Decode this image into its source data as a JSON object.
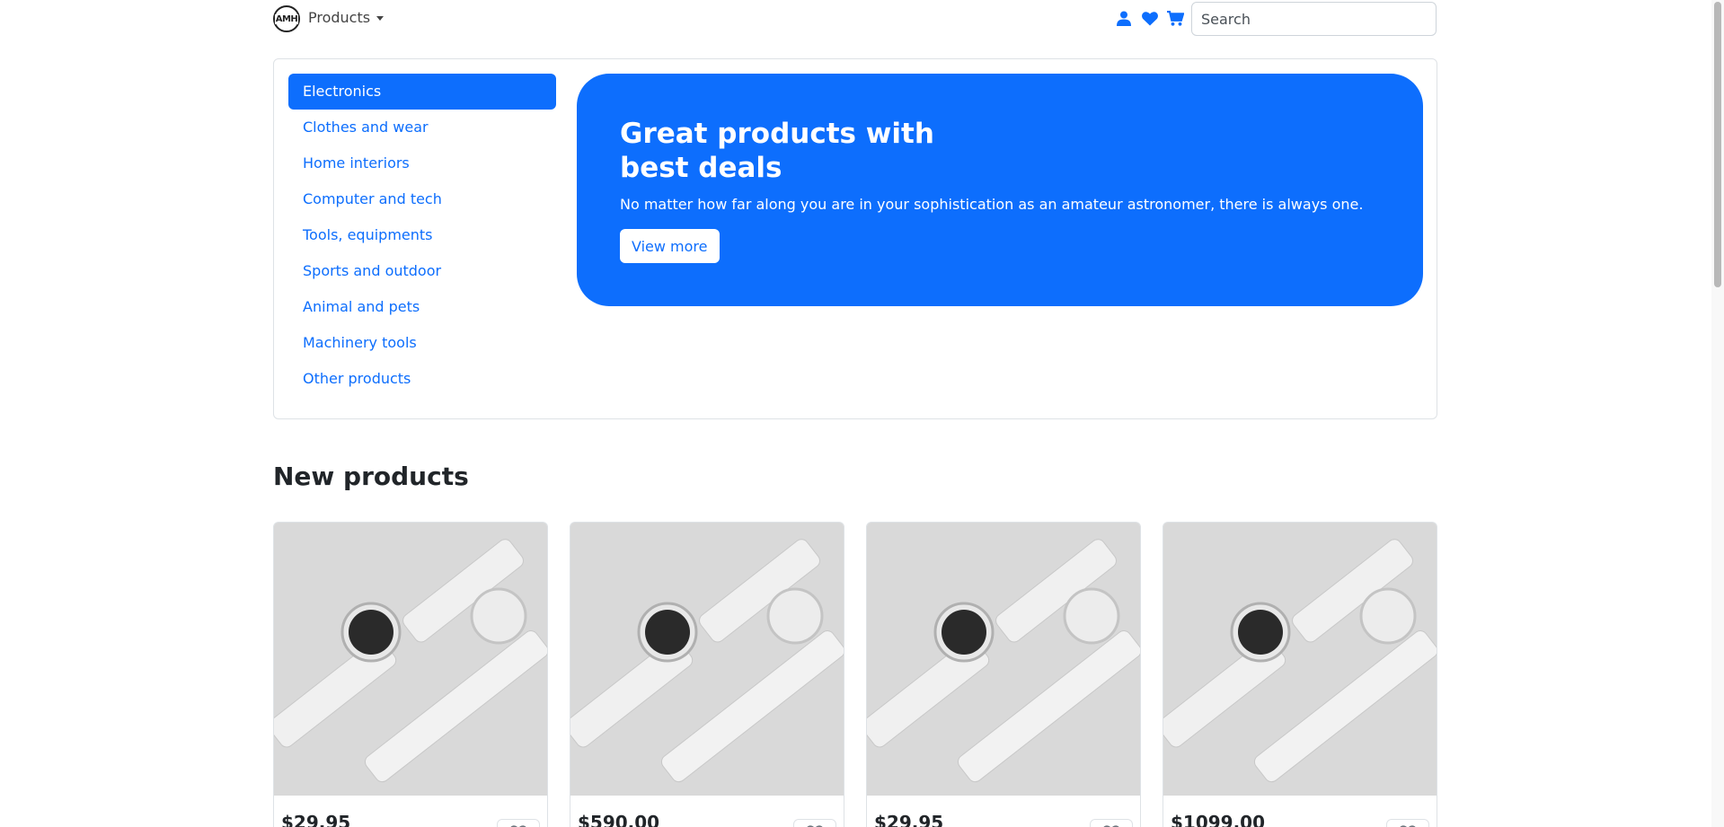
{
  "navbar": {
    "logo_text": "AMH",
    "products_label": "Products",
    "icons": [
      "user-icon",
      "heart-icon",
      "cart-icon"
    ],
    "search_placeholder": "Search"
  },
  "categories": [
    {
      "label": "Electronics",
      "active": true
    },
    {
      "label": "Clothes and wear"
    },
    {
      "label": "Home interiors"
    },
    {
      "label": "Computer and tech"
    },
    {
      "label": "Tools, equipments"
    },
    {
      "label": "Sports and outdoor"
    },
    {
      "label": "Animal and pets"
    },
    {
      "label": "Machinery tools"
    },
    {
      "label": "Other products"
    }
  ],
  "banner": {
    "title_line1": "Great products with",
    "title_line2": "best deals",
    "text": "No matter how far along you are in your sophistication as an amateur astronomer, there is always one.",
    "button_label": "View more"
  },
  "new_products": {
    "title": "New products",
    "items": [
      {
        "price": "$29.95"
      },
      {
        "price": "$590.00"
      },
      {
        "price": "$29.95"
      },
      {
        "price": "$1099.00"
      }
    ]
  },
  "colors": {
    "primary": "#0d6efd",
    "border": "#dee2e6",
    "image_bg": "#d9d9d9"
  }
}
